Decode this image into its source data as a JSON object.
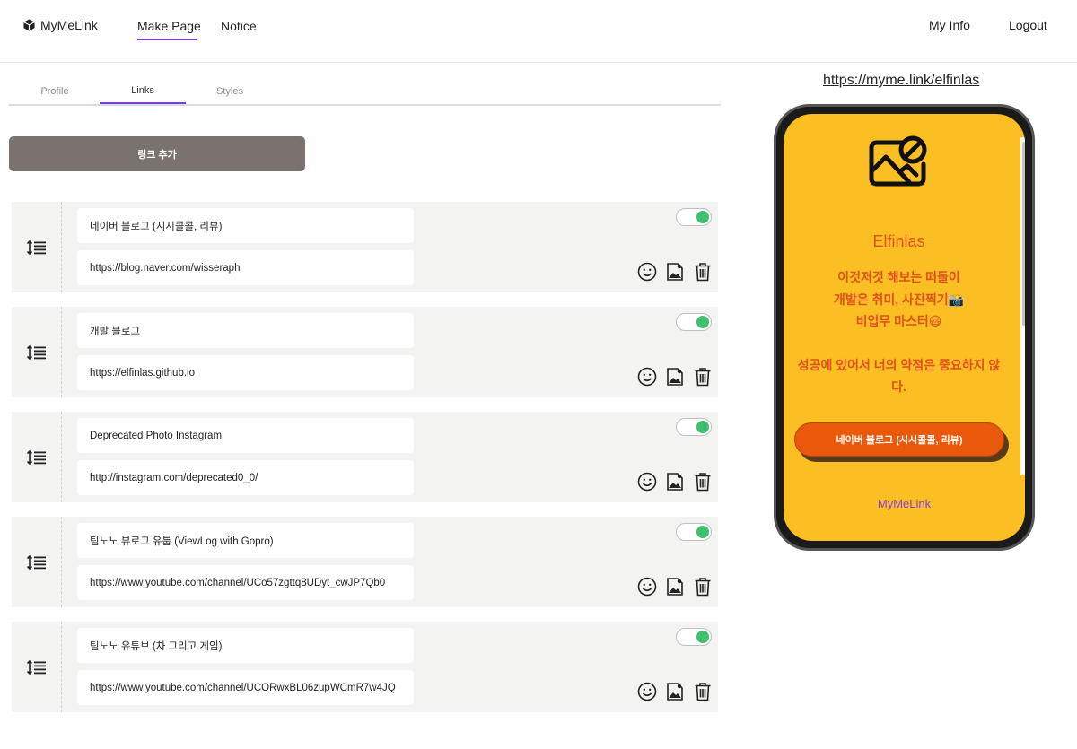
{
  "nav": {
    "brand": "MyMeLink",
    "items": [
      "Make Page",
      "Notice"
    ],
    "right": [
      "My Info",
      "Logout"
    ]
  },
  "tabs": [
    "Profile",
    "Links",
    "Styles"
  ],
  "active_tab": "Links",
  "add_link_label": "링크 추가",
  "links": [
    {
      "title": "네이버 블로그 (시시콜콜, 리뷰)",
      "url": "https://blog.naver.com/wisseraph",
      "enabled": true
    },
    {
      "title": "개발 블로그",
      "url": "https://elfinlas.github.io",
      "enabled": true
    },
    {
      "title": "Deprecated Photo Instagram",
      "url": "http://instagram.com/deprecated0_0/",
      "enabled": true
    },
    {
      "title": "팀노노 뷰로그 유툽 (ViewLog with Gopro)",
      "url": "https://www.youtube.com/channel/UCo57zgttq8UDyt_cwJP7Qb0",
      "enabled": true
    },
    {
      "title": "팀노노 유튜브 (차 그리고 게임)",
      "url": "https://www.youtube.com/channel/UCORwxBL06zupWCmR7w4JQ",
      "enabled": true
    }
  ],
  "preview": {
    "url": "https://myme.link/elfinlas",
    "name": "Elfinlas",
    "bio_lines": [
      "이것저것 해보는 떠돌이",
      "개발은 취미, 사진찍기📸",
      "비업무 마스터😷"
    ],
    "bio_quote": "성공에 있어서 너의 약점은 중요하지 않다.",
    "button_label": "네이버 블로그 (시시콜콜, 리뷰)",
    "footer": "MyMeLink"
  },
  "colors": {
    "accent": "#7b3fd8",
    "preview_bg": "#fbbf24",
    "preview_text": "#e0501a",
    "preview_button": "#ea580c",
    "toggle_on": "#3fbf6f",
    "add_button": "#7a726e"
  },
  "icons": [
    "cube-icon",
    "drag-handle-icon",
    "emoji-icon",
    "image-icon",
    "trash-icon",
    "image-off-icon"
  ]
}
